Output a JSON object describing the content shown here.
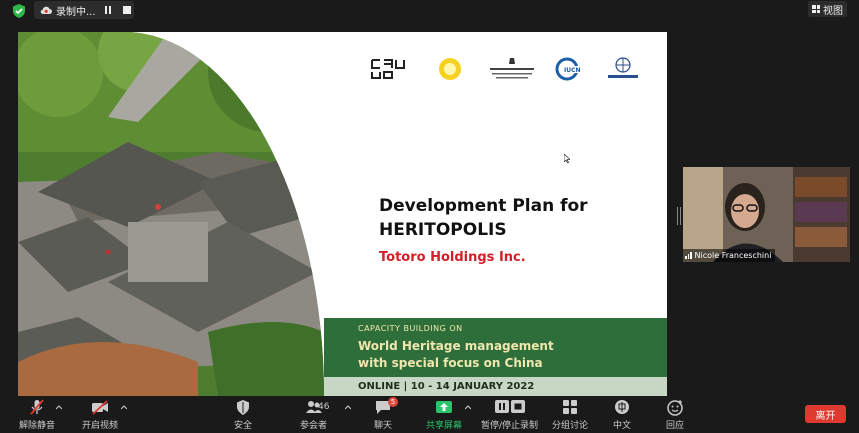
{
  "topbar": {
    "recording_label": "录制中...",
    "view_label": "视图"
  },
  "slide": {
    "title_line1": "Development Plan for",
    "title_line2": "HERITOPOLIS",
    "subtitle": "Totoro Holdings Inc.",
    "band_small": "CAPACITY BUILDING ON",
    "band_big_line1": "World Heritage management",
    "band_big_line2": "with special focus on China",
    "band_bottom": "ONLINE |  10 - 14 JANUARY 2022",
    "logos": [
      {
        "name": "caah-logo",
        "text": "CAAH"
      },
      {
        "name": "sun-emblem-logo"
      },
      {
        "name": "norway-ministry-logo",
        "text": "NORWEGIAN MINISTRY OF CLIMATE AND ENVIRONMENT"
      },
      {
        "name": "iucn-logo",
        "text": "IUCN"
      },
      {
        "name": "iccrom-logo",
        "text": "ICCROM"
      }
    ]
  },
  "video": {
    "participant_name": "Nicole Franceschini"
  },
  "toolbar": {
    "items": [
      {
        "label": "解除静音",
        "icon": "mic-muted-icon"
      },
      {
        "label": "开启视频",
        "icon": "video-off-icon"
      },
      {
        "label": "安全",
        "icon": "shield-icon"
      },
      {
        "label": "参会者",
        "icon": "participants-icon",
        "count": "46"
      },
      {
        "label": "聊天",
        "icon": "chat-icon",
        "badge": "5"
      },
      {
        "label": "共享屏幕",
        "icon": "share-screen-icon"
      },
      {
        "label": "暂停/停止录制",
        "icon": "pause-stop-record-icon"
      },
      {
        "label": "分组讨论",
        "icon": "breakout-rooms-icon"
      },
      {
        "label": "中文",
        "icon": "language-icon",
        "icon_text": "中"
      },
      {
        "label": "回应",
        "icon": "reaction-icon"
      }
    ],
    "leave_label": "离开"
  },
  "colors": {
    "band_green": "#2e6e3a",
    "subtitle_red": "#d32028",
    "share_green": "#27c46a",
    "leave_red": "#e0392f"
  }
}
